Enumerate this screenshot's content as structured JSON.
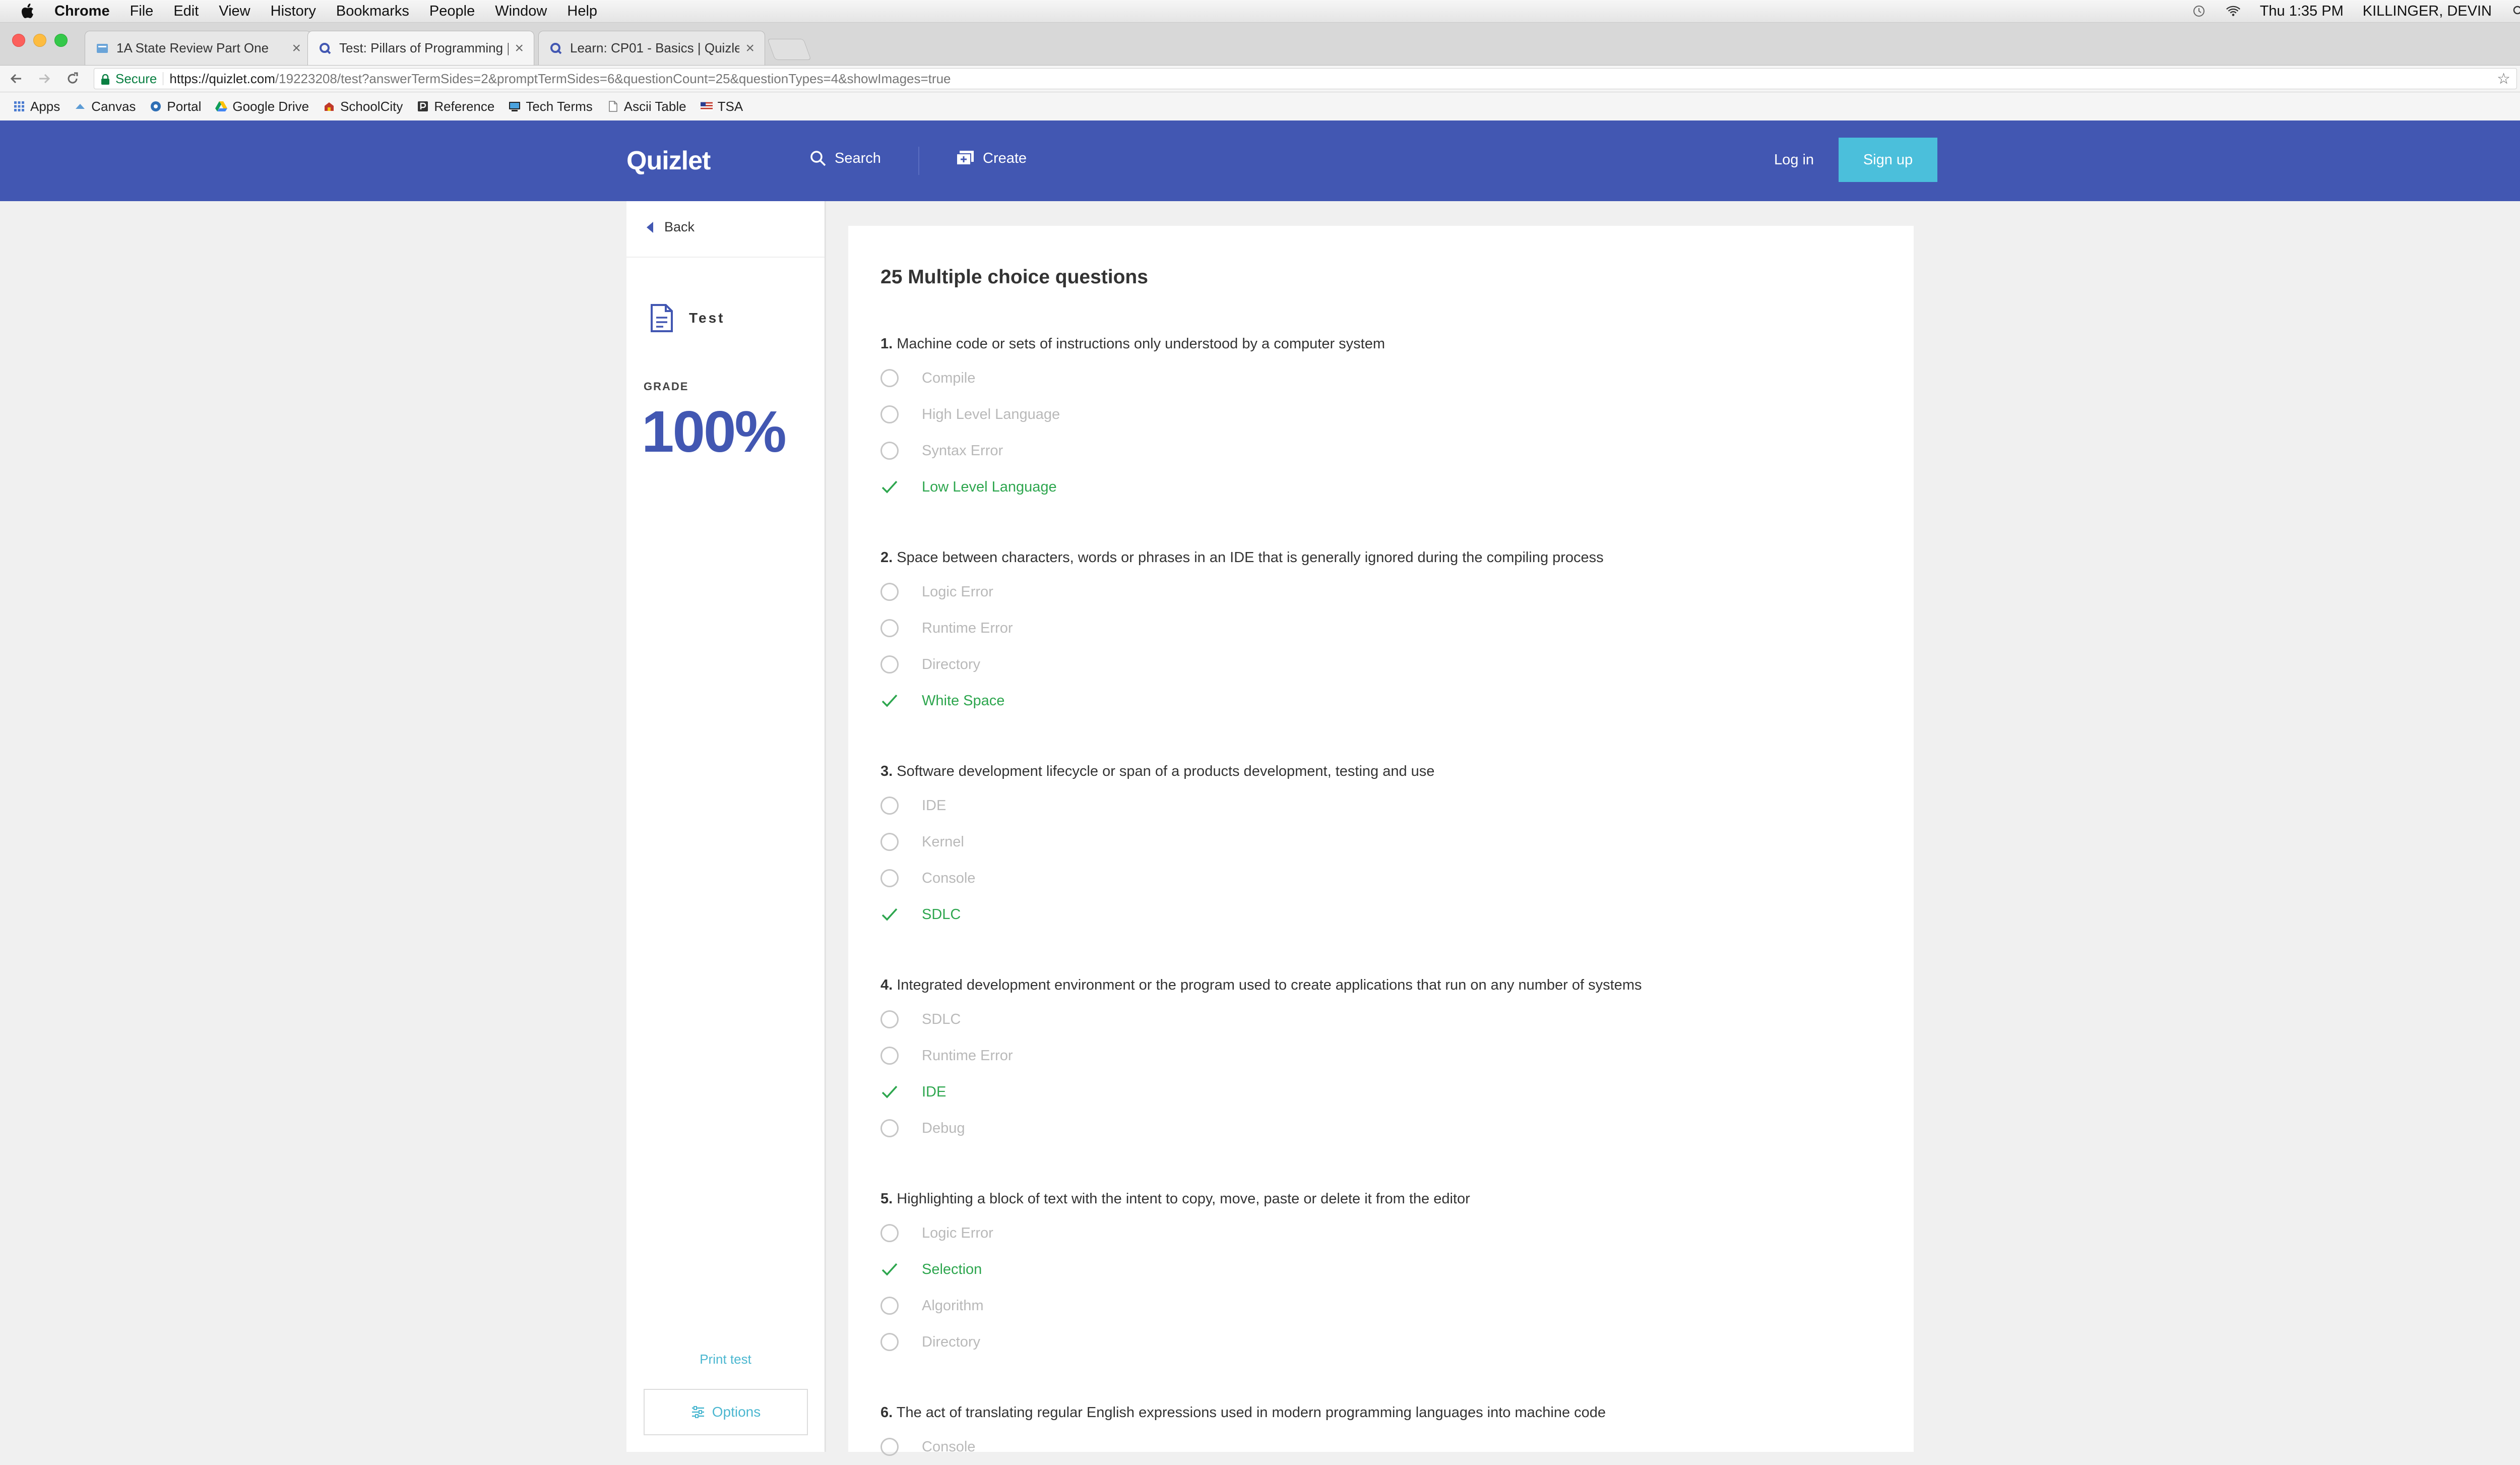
{
  "menubar": {
    "app": "Chrome",
    "items": [
      "File",
      "Edit",
      "View",
      "History",
      "Bookmarks",
      "People",
      "Window",
      "Help"
    ],
    "clock": "Thu 1:35 PM",
    "user": "KILLINGER, DEVIN"
  },
  "tabs": [
    {
      "title": "1A State Review Part One",
      "active": false
    },
    {
      "title": "Test: Pillars of Programming |",
      "active": true
    },
    {
      "title": "Learn: CP01 - Basics | Quizlet",
      "active": false
    }
  ],
  "address": {
    "secure_label": "Secure",
    "host": "https://quizlet.com",
    "path": "/19223208/test?answerTermSides=2&promptTermSides=6&questionCount=25&questionTypes=4&showImages=true"
  },
  "bookmarks": [
    "Apps",
    "Canvas",
    "Portal",
    "Google Drive",
    "SchoolCity",
    "Reference",
    "Tech Terms",
    "Ascii Table",
    "TSA"
  ],
  "header": {
    "logo": "Quizlet",
    "search": "Search",
    "create": "Create",
    "login": "Log in",
    "signup": "Sign up",
    "bg_color": "#4257b2",
    "signup_color": "#4bbfdb"
  },
  "sidebar": {
    "back": "Back",
    "mode": "Test",
    "grade_label": "GRADE",
    "grade_value": "100%",
    "print": "Print test",
    "options": "Options"
  },
  "main": {
    "title": "25 Multiple choice questions",
    "correct_color": "#2da64e",
    "questions": [
      {
        "number": "1.",
        "prompt": "Machine code or sets of instructions only understood by a computer system",
        "options": [
          {
            "text": "Compile",
            "correct": false
          },
          {
            "text": "High Level Language",
            "correct": false
          },
          {
            "text": "Syntax Error",
            "correct": false
          },
          {
            "text": "Low Level Language",
            "correct": true
          }
        ]
      },
      {
        "number": "2.",
        "prompt": "Space between characters, words or phrases in an IDE that is generally ignored during the compiling process",
        "options": [
          {
            "text": "Logic Error",
            "correct": false
          },
          {
            "text": "Runtime Error",
            "correct": false
          },
          {
            "text": "Directory",
            "correct": false
          },
          {
            "text": "White Space",
            "correct": true
          }
        ]
      },
      {
        "number": "3.",
        "prompt": "Software development lifecycle or span of a products development, testing and use",
        "options": [
          {
            "text": "IDE",
            "correct": false
          },
          {
            "text": "Kernel",
            "correct": false
          },
          {
            "text": "Console",
            "correct": false
          },
          {
            "text": "SDLC",
            "correct": true
          }
        ]
      },
      {
        "number": "4.",
        "prompt": "Integrated development environment or the program used to create applications that run on any number of systems",
        "options": [
          {
            "text": "SDLC",
            "correct": false
          },
          {
            "text": "Runtime Error",
            "correct": false
          },
          {
            "text": "IDE",
            "correct": true
          },
          {
            "text": "Debug",
            "correct": false
          }
        ]
      },
      {
        "number": "5.",
        "prompt": "Highlighting a block of text with the intent to copy, move, paste or delete it from the editor",
        "options": [
          {
            "text": "Logic Error",
            "correct": false
          },
          {
            "text": "Selection",
            "correct": true
          },
          {
            "text": "Algorithm",
            "correct": false
          },
          {
            "text": "Directory",
            "correct": false
          }
        ]
      },
      {
        "number": "6.",
        "prompt": "The act of translating regular English expressions used in modern programming languages into machine code",
        "options": [
          {
            "text": "Console",
            "correct": false
          }
        ]
      }
    ]
  }
}
